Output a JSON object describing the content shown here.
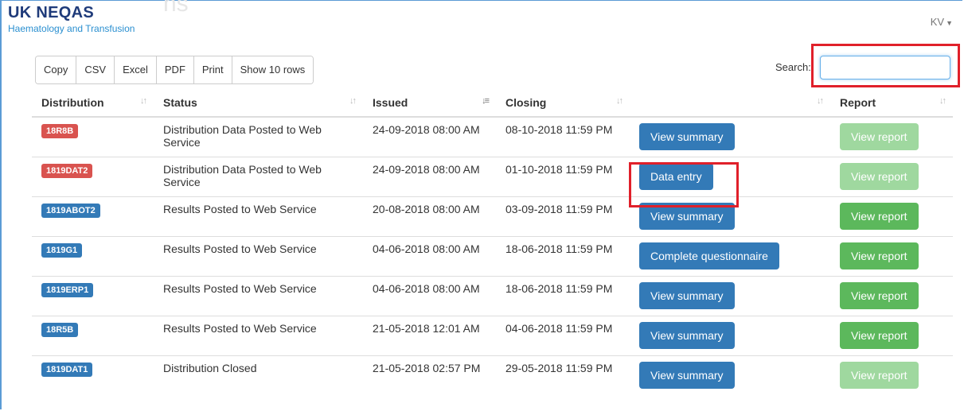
{
  "header": {
    "brand_name": "UK NEQAS",
    "brand_sub": "Haematology and Transfusion",
    "ghost_title": "ns",
    "user": "KV"
  },
  "toolbar": {
    "copy": "Copy",
    "csv": "CSV",
    "excel": "Excel",
    "pdf": "PDF",
    "print": "Print",
    "show_rows": "Show 10 rows"
  },
  "search": {
    "label": "Search:",
    "value": ""
  },
  "table": {
    "headers": {
      "distribution": "Distribution",
      "status": "Status",
      "issued": "Issued",
      "closing": "Closing",
      "action": "",
      "report": "Report"
    },
    "rows": [
      {
        "distribution": "18R8B",
        "badge_color": "red",
        "status": "Distribution Data Posted to Web Service",
        "issued": "24-09-2018 08:00 AM",
        "closing": "08-10-2018 11:59 PM",
        "action": "View summary",
        "report": "View report",
        "report_enabled": false
      },
      {
        "distribution": "1819DAT2",
        "badge_color": "red",
        "status": "Distribution Data Posted to Web Service",
        "issued": "24-09-2018 08:00 AM",
        "closing": "01-10-2018 11:59 PM",
        "action": "Data entry",
        "report": "View report",
        "report_enabled": false
      },
      {
        "distribution": "1819ABOT2",
        "badge_color": "blue",
        "status": "Results Posted to Web Service",
        "issued": "20-08-2018 08:00 AM",
        "closing": "03-09-2018 11:59 PM",
        "action": "View summary",
        "report": "View report",
        "report_enabled": true
      },
      {
        "distribution": "1819G1",
        "badge_color": "blue",
        "status": "Results Posted to Web Service",
        "issued": "04-06-2018 08:00 AM",
        "closing": "18-06-2018 11:59 PM",
        "action": "Complete questionnaire",
        "report": "View report",
        "report_enabled": true
      },
      {
        "distribution": "1819ERP1",
        "badge_color": "blue",
        "status": "Results Posted to Web Service",
        "issued": "04-06-2018 08:00 AM",
        "closing": "18-06-2018 11:59 PM",
        "action": "View summary",
        "report": "View report",
        "report_enabled": true
      },
      {
        "distribution": "18R5B",
        "badge_color": "blue",
        "status": "Results Posted to Web Service",
        "issued": "21-05-2018 12:01 AM",
        "closing": "04-06-2018 11:59 PM",
        "action": "View summary",
        "report": "View report",
        "report_enabled": true
      },
      {
        "distribution": "1819DAT1",
        "badge_color": "blue",
        "status": "Distribution Closed",
        "issued": "21-05-2018 02:57 PM",
        "closing": "29-05-2018 11:59 PM",
        "action": "View summary",
        "report": "View report",
        "report_enabled": false
      }
    ]
  },
  "colors": {
    "badge_red": "#d9534f",
    "badge_blue": "#337ab7",
    "btn_primary": "#337ab7",
    "btn_success": "#5cb85c",
    "btn_success_disabled": "#9fd89f",
    "highlight": "#e0202a"
  },
  "icons": {
    "sort": "sort-icon",
    "caret": "caret-down-icon"
  }
}
